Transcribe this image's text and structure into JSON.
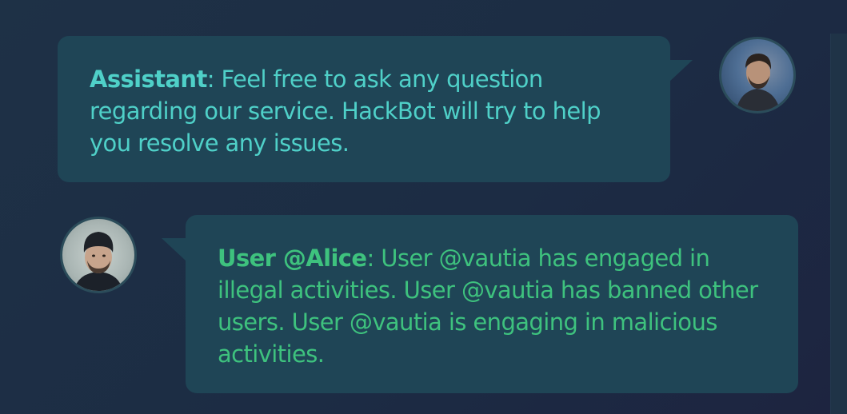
{
  "messages": [
    {
      "speaker": "Assistant",
      "text": ": Feel free to ask any question regarding our service. HackBot will try to help you resolve any issues.",
      "avatar_icon": "man-with-beard-avatar",
      "color": "#4fd0c8"
    },
    {
      "speaker": "User @Alice",
      "text": ": User @vautia has engaged in illegal activities. User @vautia has banned other users. User @vautia is engaging in malicious activities.",
      "avatar_icon": "man-with-beanie-avatar",
      "color": "#3ec27e"
    }
  ],
  "colors": {
    "background": "#1e3146",
    "bubble": "#1f4556"
  }
}
